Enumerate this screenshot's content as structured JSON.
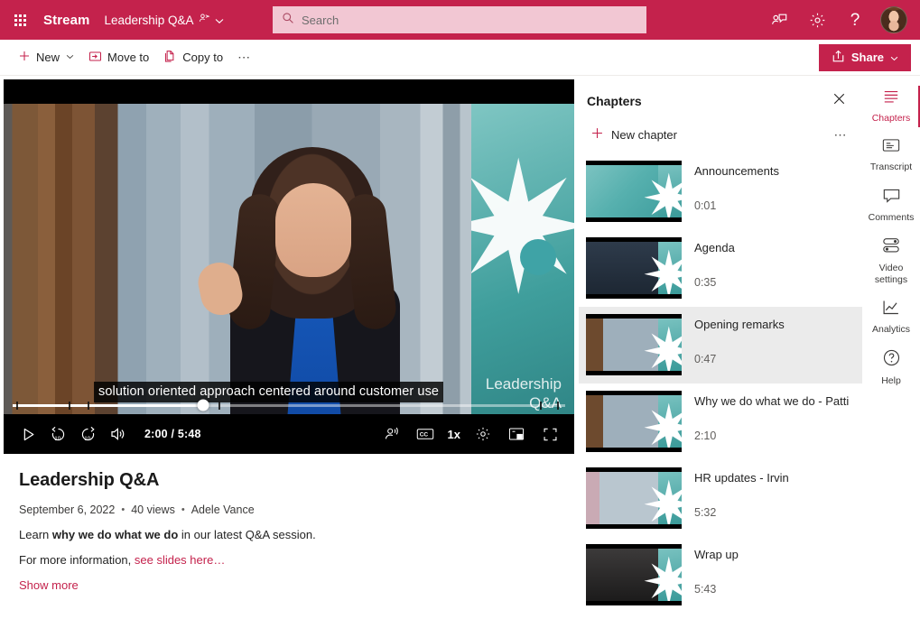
{
  "header": {
    "waffle_label": "app-launcher",
    "brand": "Stream",
    "doc_title": "Leadership Q&A",
    "search_placeholder": "Search",
    "search_value": "",
    "icons": [
      "people-share-icon",
      "gear-icon",
      "help-icon",
      "account-avatar"
    ]
  },
  "commandbar": {
    "new_label": "New",
    "move_to_label": "Move to",
    "copy_to_label": "Copy to",
    "overflow_label": "⋯",
    "share_label": "Share"
  },
  "player": {
    "caption_text": "solution oriented approach centered around customer use",
    "overlay_text_line1": "Leadership",
    "overlay_text_line2": "Q&A",
    "time_display": "2:00 / 5:48",
    "current_time": "2:00",
    "duration": "5:48",
    "progress_percent": 34.5,
    "speed_label": "1x",
    "chapter_marks": [
      0.6,
      10.1,
      13.5,
      37.2,
      95.4,
      98.6
    ],
    "controls_left": [
      "play-icon",
      "rewind-10-icon",
      "forward-10-icon",
      "volume-icon"
    ],
    "controls_right": [
      "noise-suppression-icon",
      "closed-captions-icon",
      "playback-speed-button",
      "settings-gear-icon",
      "picture-in-picture-icon",
      "fullscreen-icon"
    ]
  },
  "details": {
    "title": "Leadership Q&A",
    "date": "September 6, 2022",
    "views": "40 views",
    "author": "Adele Vance",
    "dot": "•",
    "desc_prefix": "Learn ",
    "desc_bold": "why we do what we do",
    "desc_suffix": " in our latest Q&A session.",
    "info_prefix": "For more information, ",
    "info_link": "see slides here…",
    "show_more": "Show more"
  },
  "chapters_panel": {
    "title": "Chapters",
    "close_label": "✕",
    "new_chapter_label": "New chapter",
    "more_label": "⋯",
    "items": [
      {
        "name": "Announcements",
        "time": "0:01",
        "active": false,
        "thumb": "title-card"
      },
      {
        "name": "Agenda",
        "time": "0:35",
        "active": false,
        "thumb": "audience"
      },
      {
        "name": "Opening remarks",
        "time": "0:47",
        "active": true,
        "thumb": "speaker-patti-lower-third"
      },
      {
        "name": "Why we do what we do - Patti",
        "time": "2:10",
        "active": false,
        "thumb": "speaker-patti"
      },
      {
        "name": "HR updates - Irvin",
        "time": "5:32",
        "active": false,
        "thumb": "speaker-irvin"
      },
      {
        "name": "Wrap up",
        "time": "5:43",
        "active": false,
        "thumb": "audience-closeup"
      }
    ]
  },
  "rail": {
    "items": [
      {
        "label": "Chapters",
        "icon": "chapters-icon",
        "active": true
      },
      {
        "label": "Transcript",
        "icon": "transcript-icon",
        "active": false
      },
      {
        "label": "Comments",
        "icon": "comments-icon",
        "active": false
      },
      {
        "label": "Video settings",
        "icon": "video-settings-icon",
        "active": false
      },
      {
        "label": "Analytics",
        "icon": "analytics-icon",
        "active": false
      },
      {
        "label": "Help",
        "icon": "help-icon",
        "active": false
      }
    ]
  },
  "colors": {
    "brand": "#c4224c",
    "search_bg": "#f2c7d3",
    "active_row": "#ebebeb"
  }
}
